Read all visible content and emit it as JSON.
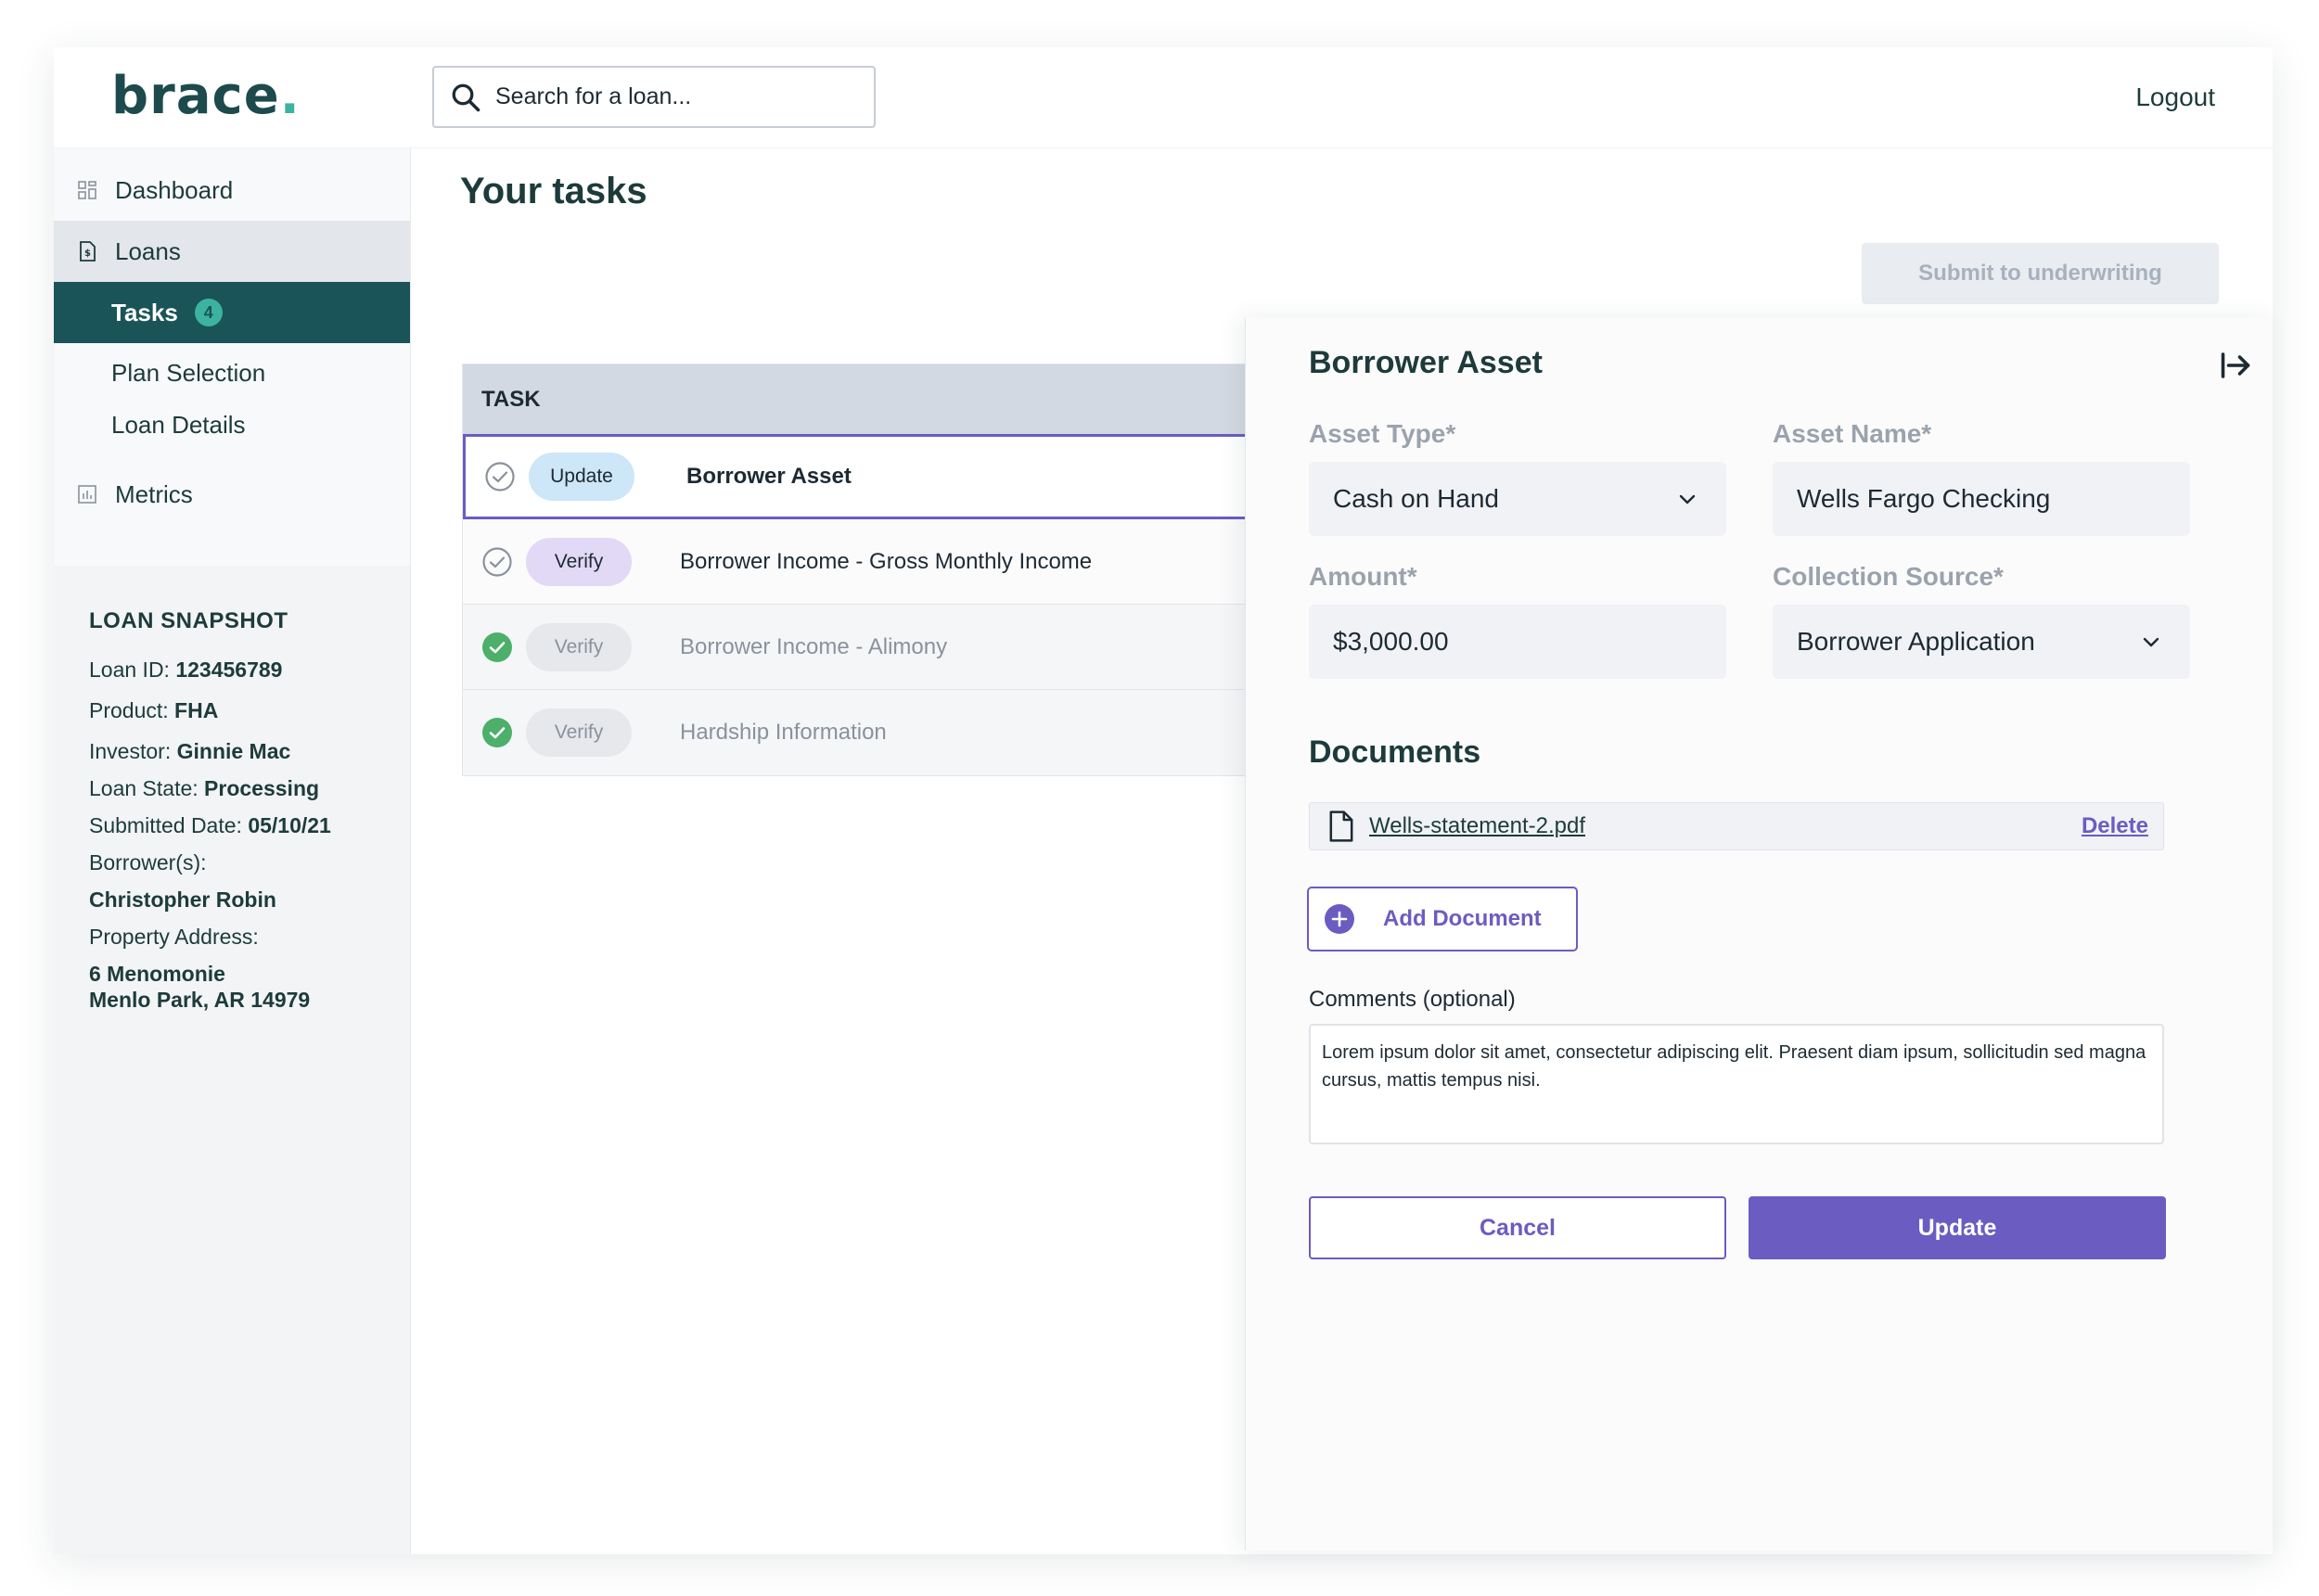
{
  "brand": {
    "name": "brace",
    "dot": ".",
    "dot_color": "#3bb3a0"
  },
  "header": {
    "search_placeholder": "Search for a loan...",
    "logout_label": "Logout"
  },
  "sidebar": {
    "dashboard": "Dashboard",
    "loans": "Loans",
    "tasks": "Tasks",
    "tasks_count": "4",
    "plan_selection": "Plan Selection",
    "loan_details": "Loan Details",
    "metrics": "Metrics"
  },
  "snapshot": {
    "title": "LOAN SNAPSHOT",
    "loan_id_label": "Loan ID: ",
    "loan_id": "123456789",
    "product_label": "Product: ",
    "product": "FHA",
    "investor_label": "Investor: ",
    "investor": "Ginnie Mac",
    "loan_state_label": "Loan State: ",
    "loan_state": "Processing",
    "submitted_label": "Submitted Date: ",
    "submitted": "05/10/21",
    "borrowers_label": "Borrower(s):",
    "borrower": "Christopher Robin",
    "property_label": "Property Address:",
    "address_line1": "6 Menomonie",
    "address_line2": "Menlo Park, AR 14979"
  },
  "main": {
    "title": "Your tasks",
    "submit_label": "Submit to underwriting",
    "table_header": "TASK",
    "tasks": [
      {
        "action": "Update",
        "name": "Borrower Asset"
      },
      {
        "action": "Verify",
        "name": "Borrower Income - Gross Monthly Income"
      },
      {
        "action": "Verify",
        "name": "Borrower Income - Alimony"
      },
      {
        "action": "Verify",
        "name": "Hardship Information"
      }
    ]
  },
  "panel": {
    "title": "Borrower Asset",
    "asset_type_label": "Asset Type*",
    "asset_type_value": "Cash on Hand",
    "asset_name_label": "Asset Name*",
    "asset_name_value": "Wells Fargo Checking",
    "amount_label": "Amount*",
    "amount_value": "$3,000.00",
    "collection_label": "Collection Source*",
    "collection_value": "Borrower Application",
    "documents_title": "Documents",
    "document_name": "Wells-statement-2.pdf",
    "delete_label": "Delete",
    "add_document_label": "Add Document",
    "comments_label": "Comments (optional)",
    "comments_value": "Lorem ipsum dolor sit amet, consectetur adipiscing elit. Praesent diam ipsum, sollicitudin sed magna cursus, mattis tempus nisi.",
    "cancel_label": "Cancel",
    "update_label": "Update"
  },
  "colors": {
    "brand_dark": "#1a5458",
    "accent_teal": "#3bb3a0",
    "accent_purple": "#6b5cc2",
    "complete_green": "#4caf6a"
  },
  "icons": {
    "search": "search-icon",
    "dashboard": "grid-icon",
    "loans": "document-icon",
    "metrics": "bar-chart-icon",
    "close": "collapse-arrow-icon",
    "file": "file-icon",
    "add": "plus-circle-icon",
    "check": "check-circle-icon"
  }
}
